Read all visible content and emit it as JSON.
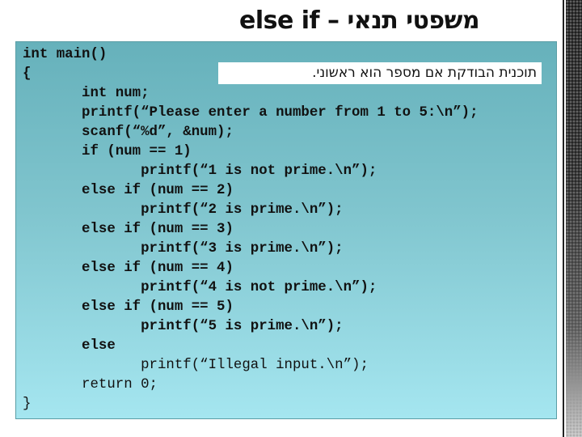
{
  "slide": {
    "title": "else if – משפטי תנאי",
    "note": "תוכנית הבודקת אם מספר הוא ראשוני."
  },
  "colors": {
    "box_top": "#66b1bb",
    "box_bottom": "#a5e6f0",
    "text": "#111111"
  },
  "code": {
    "language": "c",
    "lines": [
      "int main()",
      "{",
      "       int num;",
      "       printf(“Please enter a number from 1 to 5:\\n”);",
      "       scanf(“%d”, &num);",
      "       if (num == 1)",
      "              printf(“1 is not prime.\\n”);",
      "       else if (num == 2)",
      "              printf(“2 is prime.\\n”);",
      "       else if (num == 3)",
      "              printf(“3 is prime.\\n”);",
      "       else if (num == 4)",
      "              printf(“4 is not prime.\\n”);",
      "       else if (num == 5)",
      "              printf(“5 is prime.\\n”);",
      "       else",
      "              printf(“Illegal input.\\n”);",
      "       return 0;",
      "}"
    ]
  }
}
